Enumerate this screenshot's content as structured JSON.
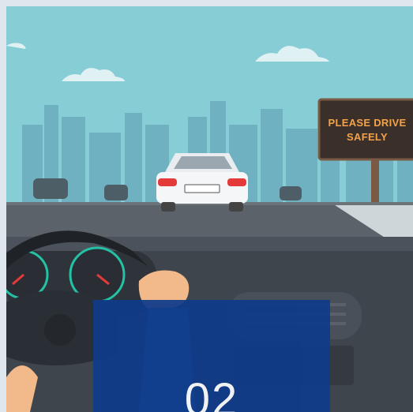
{
  "scene": {
    "sign_text_line1": "PLEASE DRIVE",
    "sign_text_line2": "SAFELY",
    "colors": {
      "sky": "#86cdd6",
      "skyline": "#6aabbb",
      "road": "#5b6269",
      "dashboard": "#3f454d",
      "car": "#f4f6f8",
      "taillight": "#e53a3a",
      "sign_board": "#3b2f2a",
      "sign_text": "#f4a24a",
      "overlay": "#0f3b8a"
    }
  },
  "overlay": {
    "number": "02"
  }
}
